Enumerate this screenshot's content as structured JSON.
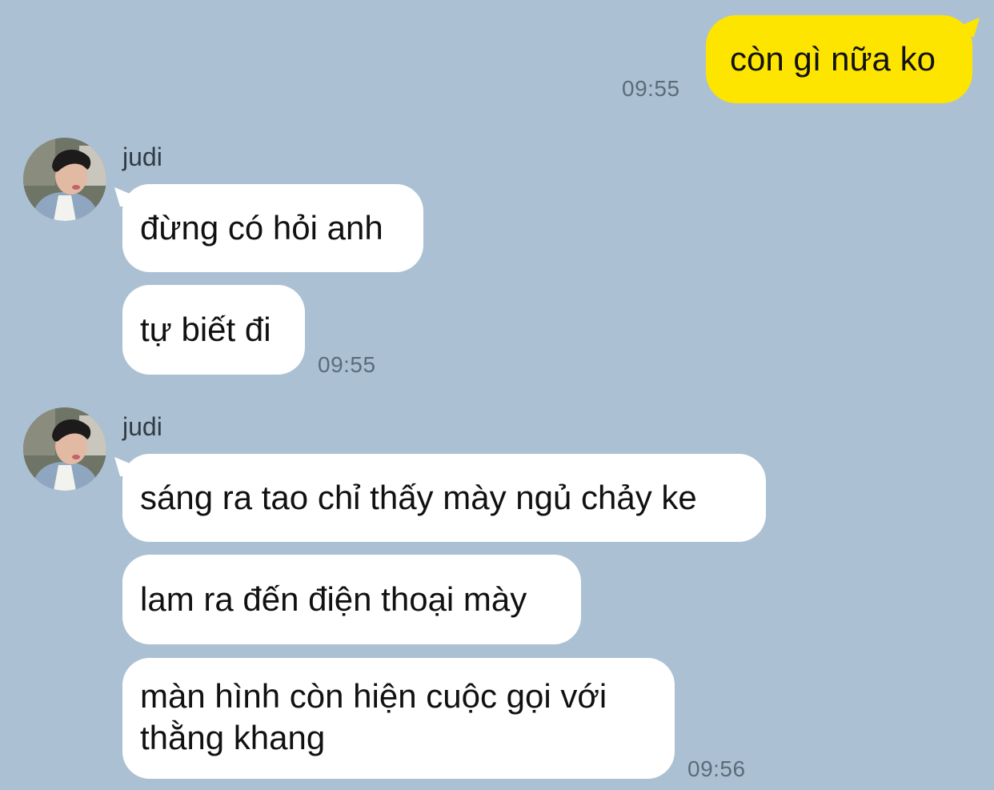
{
  "chat": {
    "outgoing": {
      "text": "còn gì nữa ko",
      "time": "09:55"
    },
    "groups": [
      {
        "sender": "judi",
        "messages": [
          "đừng có hỏi anh",
          "tự biết đi"
        ],
        "time": "09:55"
      },
      {
        "sender": "judi",
        "messages": [
          "sáng ra tao chỉ thấy mày ngủ chảy ke",
          "lam ra đến điện thoại mày",
          "màn hình còn hiện cuộc gọi với thằng khang"
        ],
        "time": "09:56"
      }
    ]
  },
  "colors": {
    "background": "#abc1d3",
    "outgoing_bubble": "#fee500",
    "incoming_bubble": "#ffffff"
  },
  "icons": {
    "avatar": "user-avatar-photo"
  }
}
